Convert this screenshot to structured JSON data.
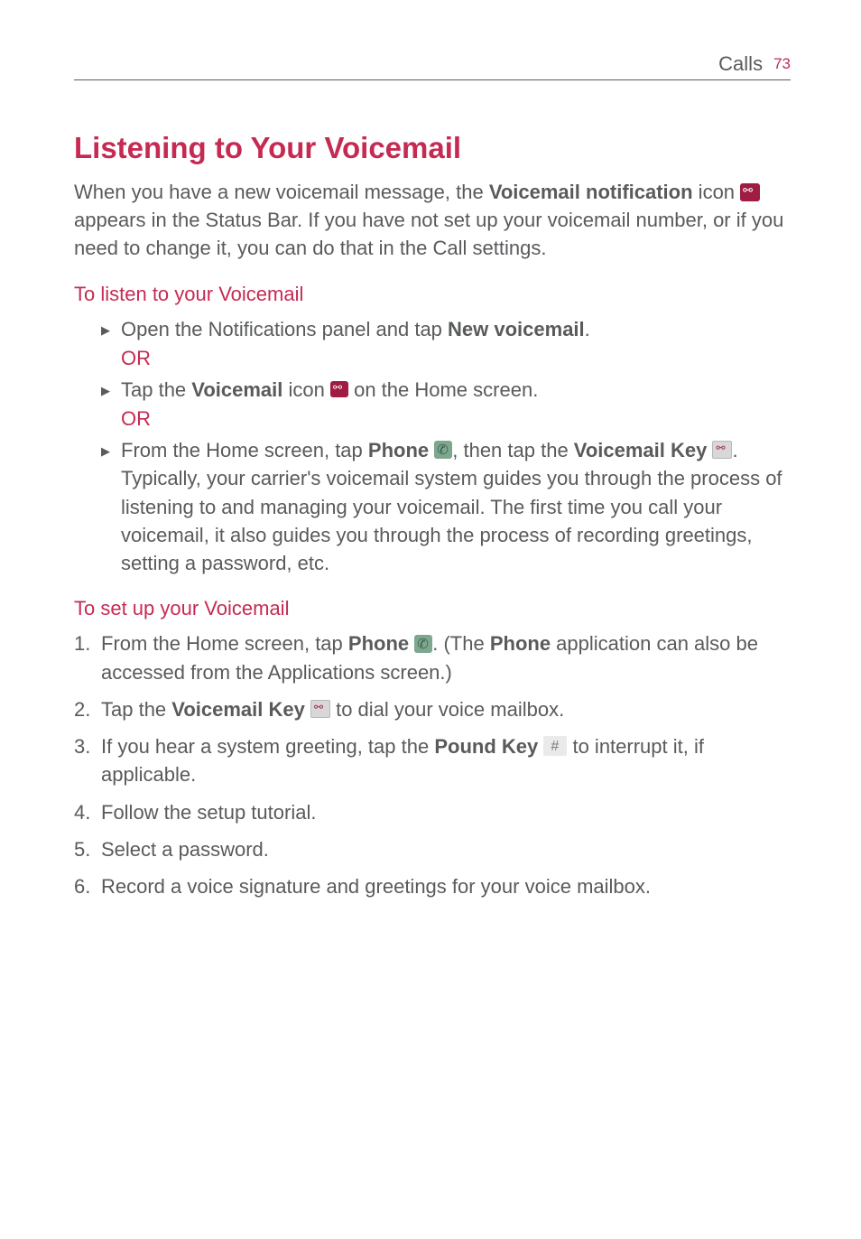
{
  "header": {
    "section": "Calls",
    "page": "73"
  },
  "title": "Listening to Your Voicemail",
  "intro": {
    "part1": "When you have a new voicemail message, the ",
    "bold1": "Voicemail notification",
    "part2": " icon ",
    "part3": " appears in the Status Bar. If you have not set up your voicemail number, or if you need to change it, you can do that in the Call settings."
  },
  "listen": {
    "heading": "To listen to your Voicemail",
    "item1": {
      "part1": "Open the Notifications panel and tap ",
      "bold1": "New voicemail",
      "part2": "."
    },
    "or": "OR",
    "item2": {
      "part1": "Tap the ",
      "bold1": "Voicemail",
      "part2": " icon ",
      "part3": " on the Home screen."
    },
    "item3": {
      "part1": "From the Home screen, tap ",
      "bold1": "Phone",
      "part2": " ",
      "part3": ", then tap the ",
      "bold2": "Voicemail Key",
      "part4": " ",
      "part5": ". Typically, your carrier's voicemail system guides you through the process of listening to and managing your voicemail. The first time you call your voicemail, it also guides you through the process of recording greetings, setting a password, etc."
    }
  },
  "setup": {
    "heading": "To set up your Voicemail",
    "step1": {
      "part1": "From the Home screen, tap ",
      "bold1": "Phone",
      "part2": " ",
      "part3": ". (The ",
      "bold2": "Phone",
      "part4": " application can also be accessed from the Applications screen.)"
    },
    "step2": {
      "part1": "Tap the ",
      "bold1": "Voicemail Key",
      "part2": " ",
      "part3": " to dial your voice mailbox."
    },
    "step3": {
      "part1": "If you hear a system greeting, tap the ",
      "bold1": "Pound Key",
      "part2": " ",
      "part3": " to interrupt it, if applicable."
    },
    "step4": "Follow the setup tutorial.",
    "step5": "Select a password.",
    "step6": "Record a voice signature and greetings for your voice mailbox."
  }
}
